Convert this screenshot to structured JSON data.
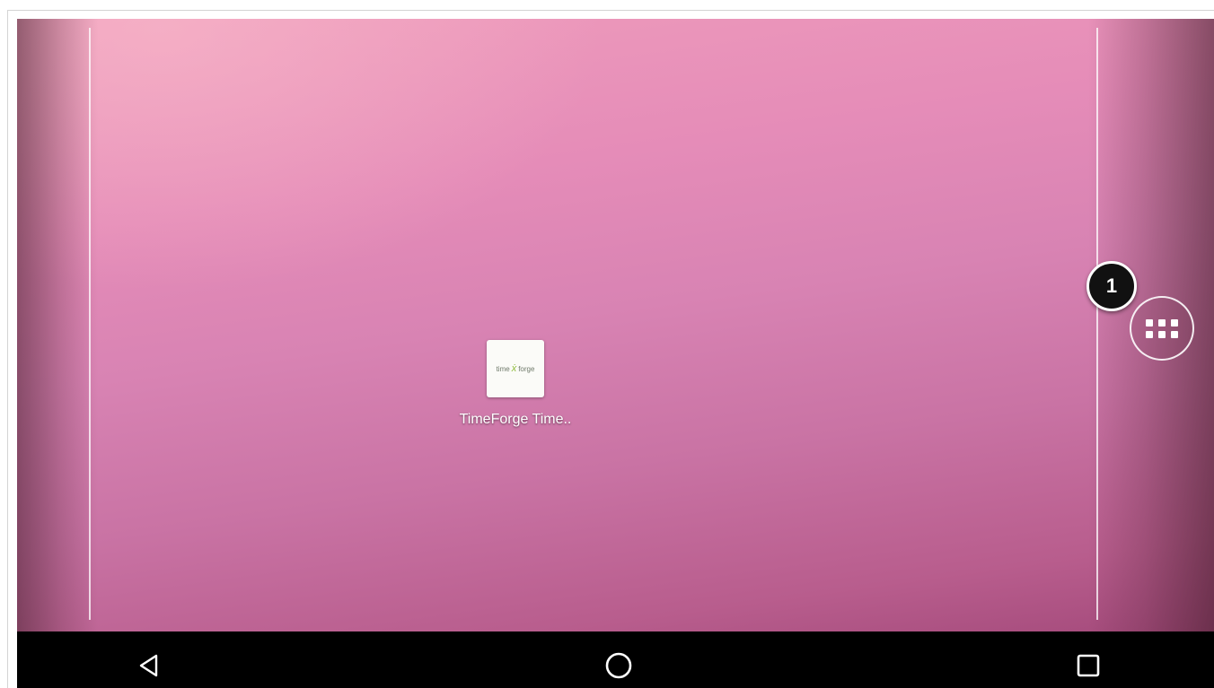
{
  "home_screen": {
    "shortcut": {
      "label": "TimeForge Time..",
      "icon_text_left": "time",
      "icon_text_right": "forge",
      "icon_name": "timeforge-logo-icon"
    },
    "app_drawer": {
      "icon_name": "app-drawer-grid-icon"
    },
    "callout": {
      "number": "1"
    }
  },
  "navigation_bar": {
    "buttons": [
      {
        "name": "back",
        "icon_name": "triangle-back-icon"
      },
      {
        "name": "home",
        "icon_name": "circle-home-icon"
      },
      {
        "name": "recents",
        "icon_name": "square-recents-icon"
      }
    ]
  },
  "colors": {
    "wallpaper_top": "#ef9dbc",
    "wallpaper_bottom": "#a44a7b",
    "navbar": "#000000",
    "callout": "#111111"
  }
}
